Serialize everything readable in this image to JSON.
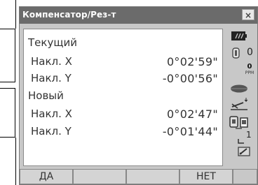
{
  "window": {
    "title": "Компенсатор/Рез-т",
    "close_glyph": "×"
  },
  "sections": {
    "current": {
      "heading": "Текущий",
      "tilt_x_label": "Накл. X",
      "tilt_x_value": "0°02'59\"",
      "tilt_y_label": "Накл. Y",
      "tilt_y_value": "-0°00'56\""
    },
    "new": {
      "heading": "Новый",
      "tilt_x_label": "Накл. X",
      "tilt_x_value": "0°02'47\"",
      "tilt_y_label": "Накл. Y",
      "tilt_y_value": "-0°01'44\""
    }
  },
  "status": {
    "prism_constant": "0",
    "ppm_value": "0",
    "ppm_unit": "PPM",
    "face_number": "1",
    "icons": [
      "battery-icon",
      "target-prism-icon",
      "ppm-icon",
      "laser-beam-icon",
      "tilt-compensation-icon",
      "bluetooth-device-icon",
      "face-icon",
      "input-mode-icon"
    ]
  },
  "softkeys": [
    "ДА",
    "",
    "",
    "НЕТ"
  ]
}
